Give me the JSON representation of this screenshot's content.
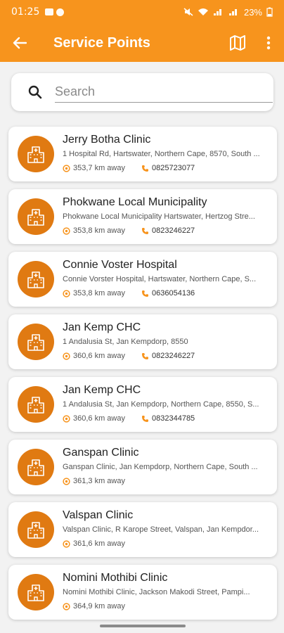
{
  "status_bar": {
    "time": "01:25",
    "battery": "23%"
  },
  "toolbar": {
    "title": "Service Points"
  },
  "search": {
    "placeholder": "Search"
  },
  "colors": {
    "accent": "#f7941d",
    "avatar": "#e07a12"
  },
  "service_points": [
    {
      "name": "Jerry Botha Clinic",
      "address": "1 Hospital Rd, Hartswater, Northern Cape, 8570, South ...",
      "distance": "353,7 km away",
      "phone": "0825723077"
    },
    {
      "name": "Phokwane Local Municipality",
      "address": "Phokwane Local Municipality Hartswater, Hertzog Stre...",
      "distance": "353,8 km away",
      "phone": "0823246227"
    },
    {
      "name": "Connie Voster Hospital",
      "address": "Connie Vorster Hospital, Hartswater, Northern Cape, S...",
      "distance": "353,8 km away",
      "phone": "0636054136"
    },
    {
      "name": "Jan Kemp CHC",
      "address": "1 Andalusia St, Jan Kempdorp, 8550",
      "distance": "360,6 km away",
      "phone": "0823246227"
    },
    {
      "name": "Jan Kemp CHC",
      "address": "1 Andalusia St, Jan Kempdorp, Northern Cape, 8550, S...",
      "distance": "360,6 km away",
      "phone": "0832344785"
    },
    {
      "name": "Ganspan Clinic",
      "address": "Ganspan Clinic, Jan Kempdorp, Northern Cape, South ...",
      "distance": "361,3 km away"
    },
    {
      "name": "Valspan Clinic",
      "address": "Valspan Clinic, R Karope Street, Valspan, Jan Kempdor...",
      "distance": "361,6 km away"
    },
    {
      "name": "Nomini Mothibi Clinic",
      "address": "Nomini Mothibi Clinic, Jackson Makodi Street, Pampi...",
      "distance": "364,9 km away"
    }
  ]
}
